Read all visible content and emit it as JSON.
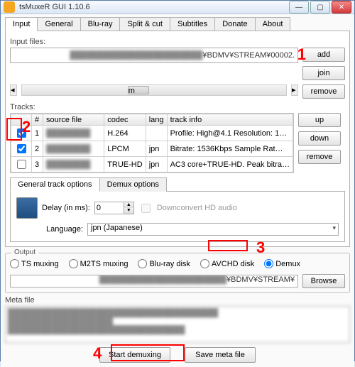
{
  "window": {
    "title": "tsMuxeR GUI 1.10.6"
  },
  "tabs": [
    "Input",
    "General",
    "Blu-ray",
    "Split & cut",
    "Subtitles",
    "Donate",
    "About"
  ],
  "activeTab": 0,
  "input": {
    "label": "Input files:",
    "path_visible": "¥BDMV¥STREAM¥00002.",
    "buttons": {
      "add": "add",
      "join": "join",
      "remove": "remove"
    },
    "scroll_marker": "m"
  },
  "tracks": {
    "label": "Tracks:",
    "headers": {
      "chk": "",
      "num": "#",
      "source": "source file",
      "codec": "codec",
      "lang": "lang",
      "info": "track info"
    },
    "rows": [
      {
        "checked": true,
        "num": "1",
        "source": "",
        "codec": "H.264",
        "lang": "",
        "info": "Profile: High@4.1   Resolution: 1…"
      },
      {
        "checked": true,
        "num": "2",
        "source": "",
        "codec": "LPCM",
        "lang": "jpn",
        "info": "Bitrate: 1536Kbps   Sample Rat…"
      },
      {
        "checked": false,
        "num": "3",
        "source": "",
        "codec": "TRUE-HD",
        "lang": "jpn",
        "info": "AC3 core+TRUE-HD. Peak bitra…"
      }
    ],
    "buttons": {
      "up": "up",
      "down": "down",
      "remove": "remove"
    }
  },
  "track_options": {
    "tabs": [
      "General track options",
      "Demux options"
    ],
    "delay_label": "Delay (in ms):",
    "delay_value": "0",
    "downconvert_label": "Downconvert HD audio",
    "downconvert_checked": false,
    "language_label": "Language:",
    "language_value": "jpn (Japanese)"
  },
  "output": {
    "title": "Output",
    "radios": [
      {
        "label": "TS muxing",
        "checked": false
      },
      {
        "label": "M2TS muxing",
        "checked": false
      },
      {
        "label": "Blu-ray disk",
        "checked": false
      },
      {
        "label": "AVCHD disk",
        "checked": false
      },
      {
        "label": "Demux",
        "checked": true
      }
    ],
    "path_visible": "¥BDMV¥STREAM¥",
    "browse": "Browse"
  },
  "meta": {
    "label": "Meta file"
  },
  "bottom": {
    "start": "Start demuxing",
    "save": "Save meta file"
  },
  "markers": {
    "m1": "1",
    "m2": "2",
    "m3": "3",
    "m4": "4"
  }
}
